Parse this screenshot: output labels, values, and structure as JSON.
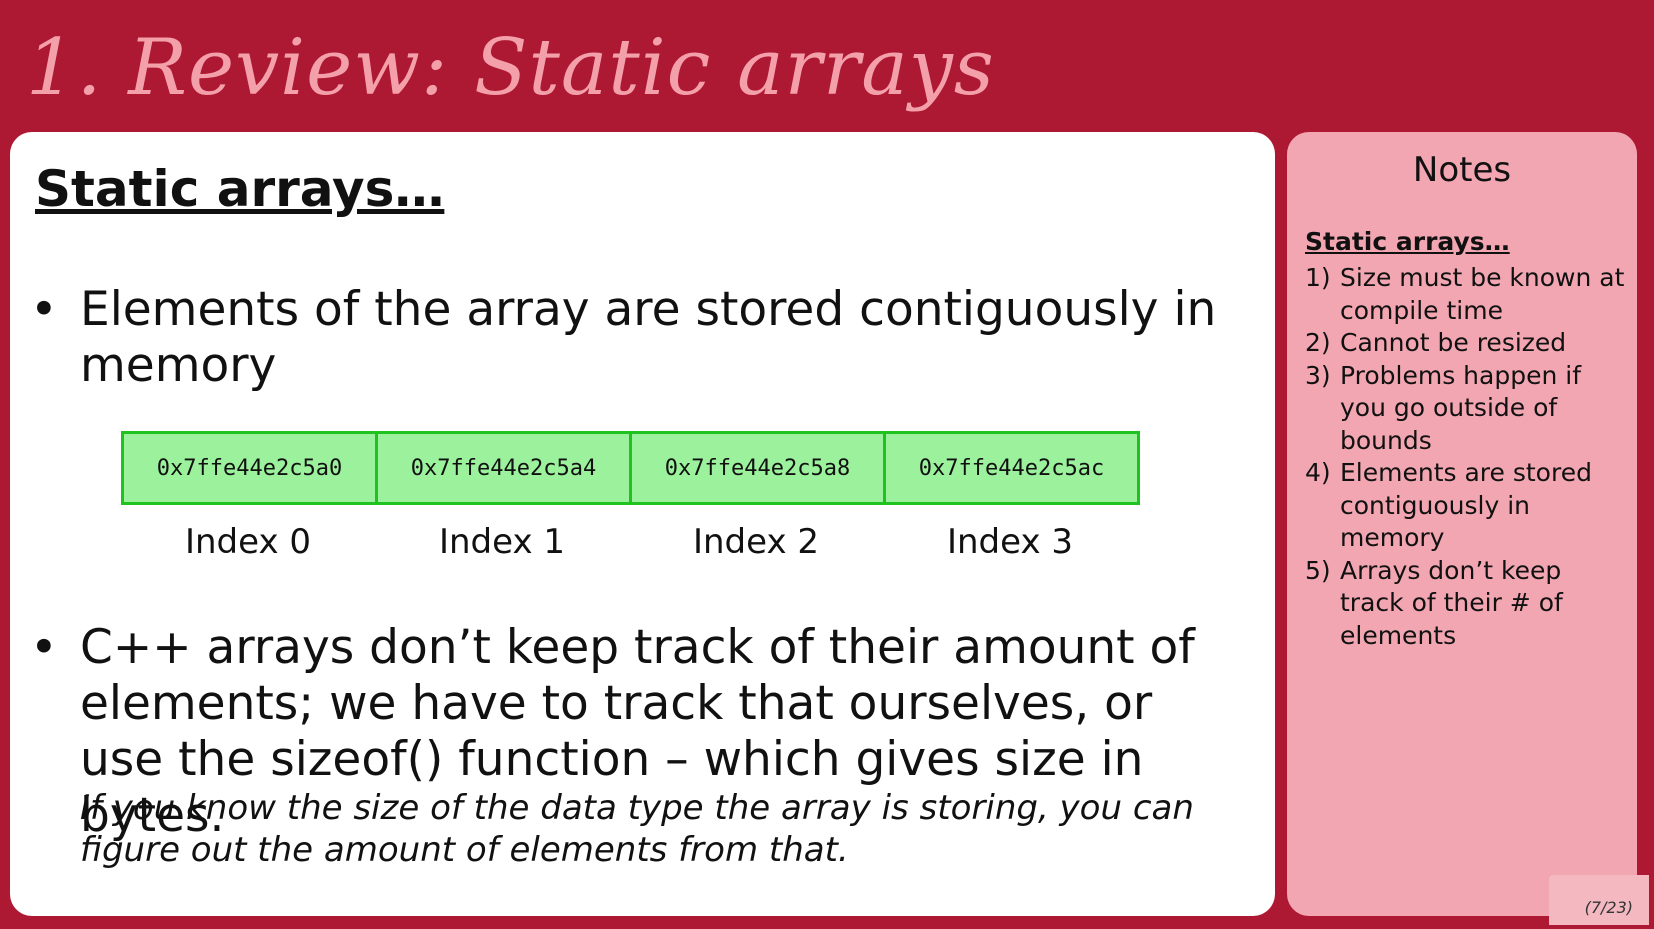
{
  "slide": {
    "title": "1. Review: Static arrays"
  },
  "main": {
    "heading": "Static arrays…",
    "bullets": [
      "Elements of the array are stored contiguously in memory",
      "C++ arrays don’t keep track of their amount of elements; we have to track that ourselves, or use the sizeof() function – which gives size in bytes."
    ],
    "bullet_symbol": "•",
    "note": "If you know the size of the data type the array is storing, you can figure out the amount of elements from that.",
    "array": {
      "addresses": [
        "0x7ffe44e2c5a0",
        "0x7ffe44e2c5a4",
        "0x7ffe44e2c5a8",
        "0x7ffe44e2c5ac"
      ],
      "index_labels": [
        "Index 0",
        "Index 1",
        "Index 2",
        "Index 3"
      ],
      "cell_color": "#9cf29c",
      "border_color": "#1fc21f"
    }
  },
  "notes": {
    "title": "Notes",
    "heading": "Static arrays…",
    "items": [
      {
        "num": "1)",
        "text": "Size must be known at compile time"
      },
      {
        "num": "2)",
        "text": "Cannot be resized"
      },
      {
        "num": "3)",
        "text": "Problems happen if you go outside of bounds"
      },
      {
        "num": "4)",
        "text": "Elements are stored contiguously in memory"
      },
      {
        "num": "5)",
        "text": "Arrays don’t keep track of their # of elements"
      }
    ]
  },
  "page_counter": "(7/23)",
  "colors": {
    "background": "#ad1832",
    "title": "#f4a0aa",
    "notes_panel": "#f2a6b1"
  }
}
